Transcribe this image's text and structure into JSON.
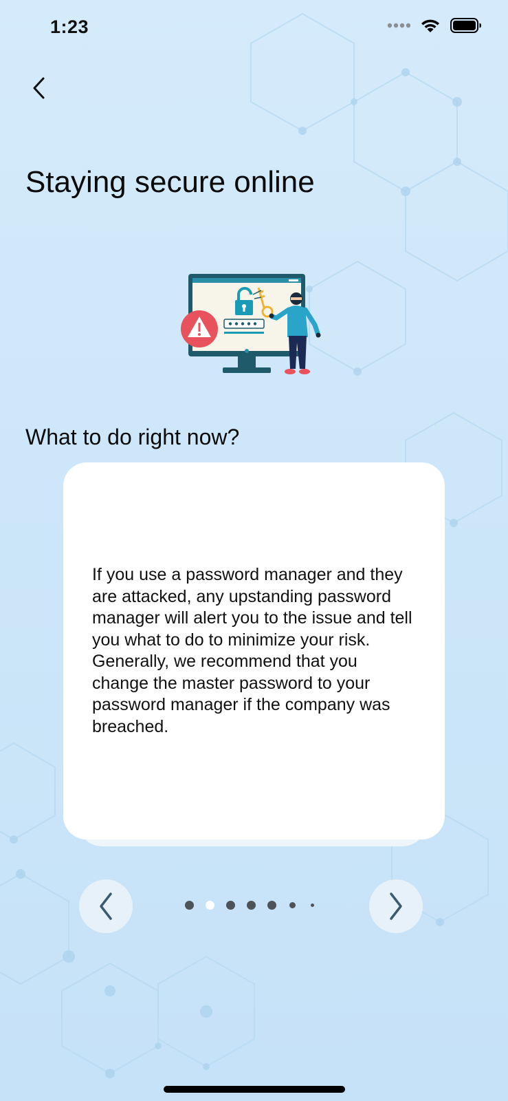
{
  "status_bar": {
    "time": "1:23",
    "icons": [
      "signal-icon",
      "wifi-icon",
      "battery-icon"
    ]
  },
  "header": {
    "back_icon": "chevron-left-icon",
    "title": "Staying secure online"
  },
  "illustration": {
    "description_icon": "hacker-unlocking-computer-illustration"
  },
  "section": {
    "heading": "What to do right now?"
  },
  "card": {
    "text": "If you use a password manager and they are attacked, any upstanding password manager will alert you to the issue and tell you what to do to minimize your risk. Generally, we recommend that you change the master password to your password manager if the company was breached."
  },
  "pager": {
    "prev_icon": "chevron-left-icon",
    "next_icon": "chevron-right-icon",
    "total_pages": 7,
    "current_page": 2
  },
  "colors": {
    "background": "#cfe7fa",
    "card": "#ffffff",
    "nav_button": "#e6f1f9",
    "chevron": "#3c5a6e",
    "dot": "#4d5358",
    "dot_active": "#ffffff",
    "warning": "#e8525c",
    "monitor": "#1e5a69",
    "lock": "#1a9bb5",
    "key": "#f2b233"
  }
}
